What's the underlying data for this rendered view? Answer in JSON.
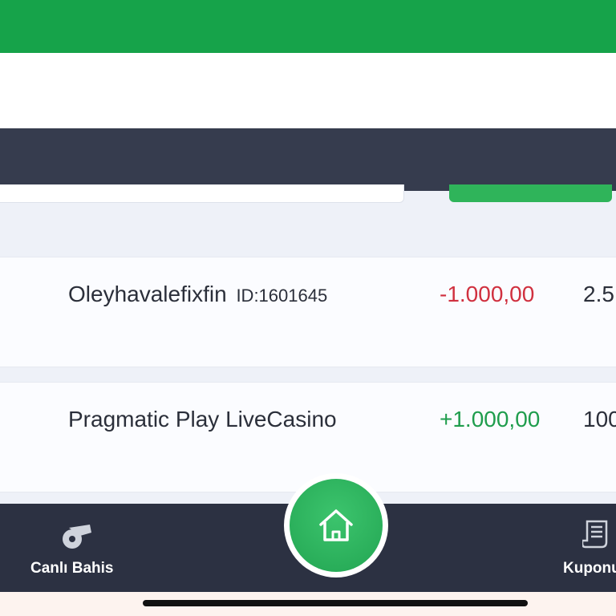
{
  "transactions": [
    {
      "name": "Oleyhavalefixfin",
      "id_label": "ID:1601645",
      "amount": "-1.000,00",
      "extra": "2.5"
    },
    {
      "name": "Pragmatic Play LiveCasino",
      "id_label": "",
      "amount": "+1.000,00",
      "extra": "100"
    }
  ],
  "bottom_nav": {
    "live_label": "Canlı Bahis",
    "coupon_label": "Kuponu"
  },
  "icons": {
    "live": "whistle-icon",
    "home": "home-icon",
    "coupon": "receipt-icon"
  },
  "colors": {
    "brand_green": "#16a34a",
    "negative": "#d0303f",
    "positive": "#1f9d4d",
    "nav_bg": "#2c3142"
  }
}
